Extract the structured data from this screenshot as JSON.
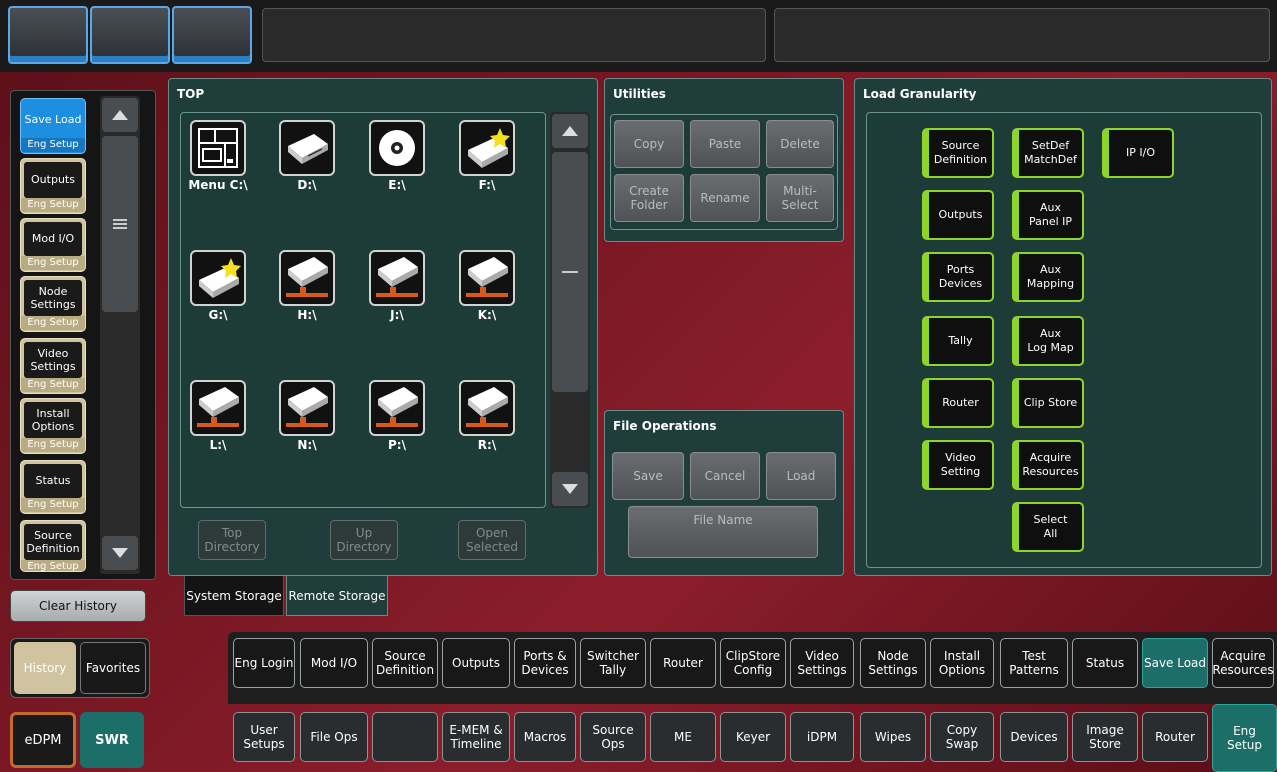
{
  "nav": {
    "items": [
      {
        "main": "Save Load",
        "sub": "Eng Setup",
        "selected": true
      },
      {
        "main": "Outputs",
        "sub": "Eng Setup"
      },
      {
        "main": "Mod I/O",
        "sub": "Eng Setup"
      },
      {
        "main": "Node\nSettings",
        "sub": "Eng Setup"
      },
      {
        "main": "Video\nSettings",
        "sub": "Eng Setup"
      },
      {
        "main": "Install\nOptions",
        "sub": "Eng Setup"
      },
      {
        "main": "Status",
        "sub": "Eng Setup"
      },
      {
        "main": "Source\nDefinition",
        "sub": "Eng Setup"
      }
    ],
    "clear_history": "Clear History",
    "history": "History",
    "favorites": "Favorites",
    "edpm": "eDPM",
    "swr": "SWR"
  },
  "top_panel": {
    "title": "TOP",
    "drives": [
      "Menu C:\\",
      "D:\\",
      "E:\\",
      "F:\\",
      "G:\\",
      "H:\\",
      "J:\\",
      "K:\\",
      "L:\\",
      "N:\\",
      "P:\\",
      "R:\\"
    ],
    "top_directory": "Top\nDirectory",
    "up_directory": "Up\nDirectory",
    "open_selected": "Open\nSelected",
    "tab_system": "System Storage",
    "tab_remote": "Remote Storage"
  },
  "utilities": {
    "title": "Utilities",
    "copy": "Copy",
    "paste": "Paste",
    "delete": "Delete",
    "create_folder": "Create\nFolder",
    "rename": "Rename",
    "multi_select": "Multi-\nSelect"
  },
  "file_ops": {
    "title": "File Operations",
    "save": "Save",
    "cancel": "Cancel",
    "load": "Load",
    "file_name": "File Name"
  },
  "granularity": {
    "title": "Load Granularity",
    "buttons": [
      "Source\nDefinition",
      "SetDef\nMatchDef",
      "IP I/O",
      "Outputs",
      "Aux\nPanel IP",
      "Ports\nDevices",
      "Aux\nMapping",
      "Tally",
      "Aux\nLog Map",
      "Router",
      "Clip Store",
      "Video\nSetting",
      "Acquire\nResources",
      "Select\nAll"
    ]
  },
  "tabs_row1": [
    "Eng Login",
    "Mod I/O",
    "Source\nDefinition",
    "Outputs",
    "Ports &\nDevices",
    "Switcher\nTally",
    "Router",
    "ClipStore\nConfig",
    "Video\nSettings",
    "Node\nSettings",
    "Install\nOptions",
    "Test\nPatterns",
    "Status",
    "Save Load",
    "Acquire\nResources"
  ],
  "tabs_row2": [
    "User\nSetups",
    "File Ops",
    "",
    "E-MEM &\nTimeline",
    "Macros",
    "Source\nOps",
    "ME",
    "Keyer",
    "iDPM",
    "Wipes",
    "Copy\nSwap",
    "Devices",
    "Image\nStore",
    "Router",
    "Eng\nSetup"
  ],
  "colors": {
    "accent_green": "#8fd42a",
    "selected_teal": "#1c6e68",
    "nav_tan": "#cfc3a0",
    "selected_blue": "#1e8fe0"
  }
}
